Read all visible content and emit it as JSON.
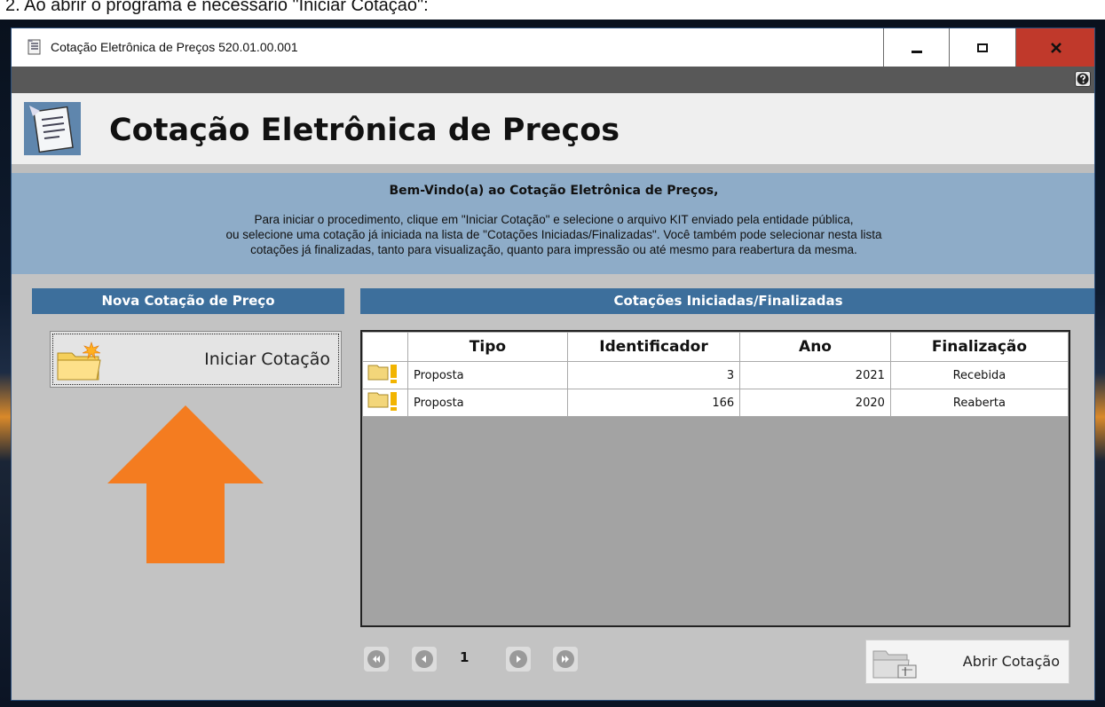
{
  "document_text": "2. Ao abrir o programa é necessário \"Iniciar Cotação\":",
  "window": {
    "title": "Cotação Eletrônica de Preços 520.01.00.001",
    "icon": "document-list-icon",
    "controls": {
      "minimize_icon": "minimize-icon",
      "maximize_icon": "maximize-icon",
      "close_icon": "close-icon"
    }
  },
  "header": {
    "title": "Cotação Eletrônica de Preços",
    "icon": "document-form-icon"
  },
  "welcome": {
    "title": "Bem-Vindo(a) ao Cotação Eletrônica de Preços,",
    "line1": "Para iniciar o procedimento, clique em \"Iniciar Cotação\" e selecione o arquivo KIT enviado pela entidade pública,",
    "line2": "ou selecione uma cotação já iniciada na lista de \"Cotações Iniciadas/Finalizadas\". Você também pode selecionar nesta lista",
    "line3": "cotações já finalizadas, tanto para visualização, quanto para impressão ou até mesmo para reabertura da mesma."
  },
  "left_panel": {
    "header": "Nova Cotação de Preço",
    "button_label": "Iniciar Cotação",
    "button_icon": "new-folder-icon",
    "annotation": "up-arrow-icon"
  },
  "right_panel": {
    "header": "Cotações Iniciadas/Finalizadas",
    "columns": [
      "",
      "Tipo",
      "Identificador",
      "Ano",
      "Finalização"
    ],
    "rows": [
      {
        "tipo": "Proposta",
        "identificador": "3",
        "ano": "2021",
        "finalizacao": "Recebida"
      },
      {
        "tipo": "Proposta",
        "identificador": "166",
        "ano": "2020",
        "finalizacao": "Reaberta"
      }
    ],
    "row_icon": "folder-alert-icon",
    "page": "1",
    "abrir_label": "Abrir Cotação",
    "abrir_icon": "open-folder-icon"
  },
  "colors": {
    "accent": "#3d6f9c",
    "welcome_bg": "#8eacc8",
    "close": "#c0392b",
    "arrow": "#f47c20"
  }
}
